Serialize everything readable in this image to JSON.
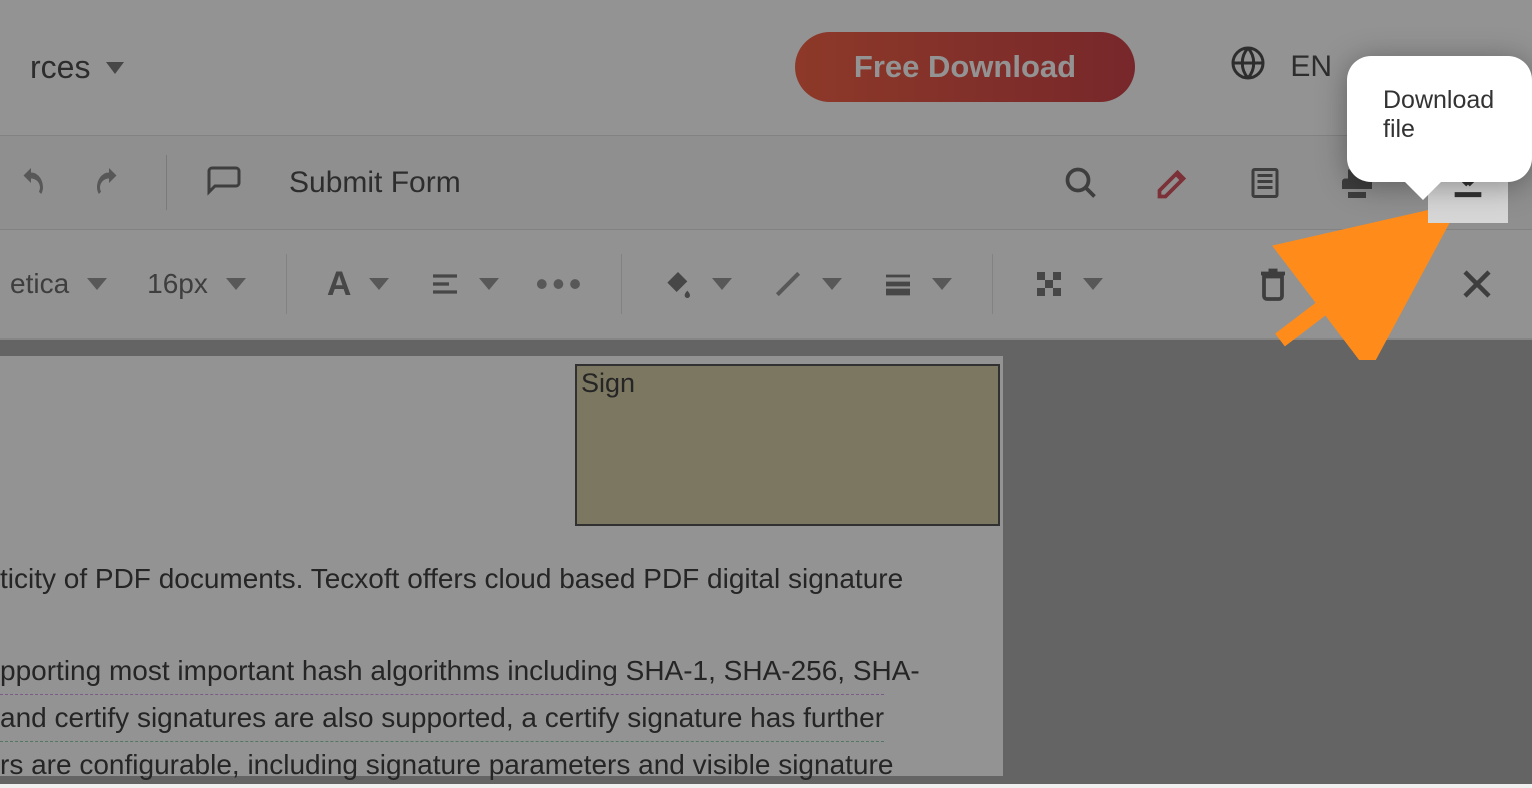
{
  "header": {
    "nav_item_partial": "rces",
    "free_download": "Free Download",
    "language": "EN",
    "tooltip": "Download file"
  },
  "toolbar1": {
    "submit": "Submit Form"
  },
  "toolbar2": {
    "font_name": "etica",
    "font_size": "16px"
  },
  "document": {
    "sign_label": "Sign",
    "line1": "ticity of PDF documents. Tecxoft offers cloud based PDF digital signature",
    "line2": "",
    "line3": "pporting most important hash algorithms including SHA-1, SHA-256, SHA-",
    "line4": "and certify signatures are also supported, a certify signature has further",
    "line5": "rs are configurable, including signature parameters and visible signature"
  }
}
